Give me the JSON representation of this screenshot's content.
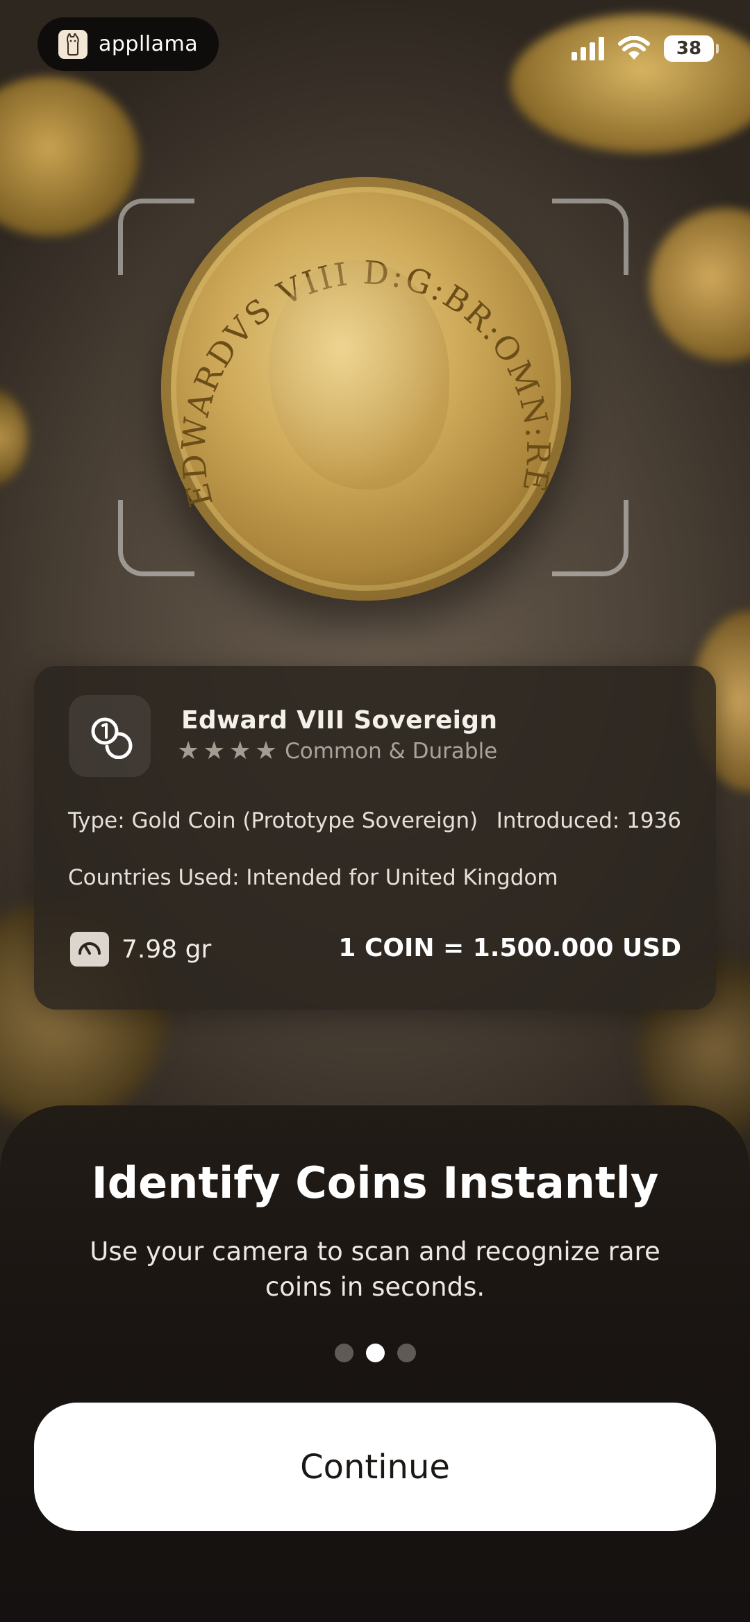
{
  "status_bar": {
    "brand_name": "appllama",
    "battery_level": "38",
    "icons": [
      "llama-logo-icon",
      "cellular-signal-icon",
      "wifi-icon",
      "battery-icon"
    ]
  },
  "coin_image": {
    "legend": "EDWARDVS VIII D:G:BR:OMN:REX F:D:IND:IMP"
  },
  "coin_card": {
    "icon": "coins-icon",
    "name": "Edward VIII Sovereign",
    "stars": 4,
    "rarity": "Common & Durable",
    "type": "Type: Gold Coin (Prototype Sovereign)",
    "introduced": "Introduced: 1936",
    "countries": "Countries Used: Intended for United Kingdom",
    "weight_icon": "scale-icon",
    "weight": "7.98 gr",
    "price": "1 COIN = 1.500.000 USD"
  },
  "onboarding": {
    "title": "Identify Coins Instantly",
    "subtitle": "Use your camera to scan and recognize rare coins in seconds.",
    "page_count": 3,
    "active_page": 2,
    "continue_label": "Continue"
  }
}
